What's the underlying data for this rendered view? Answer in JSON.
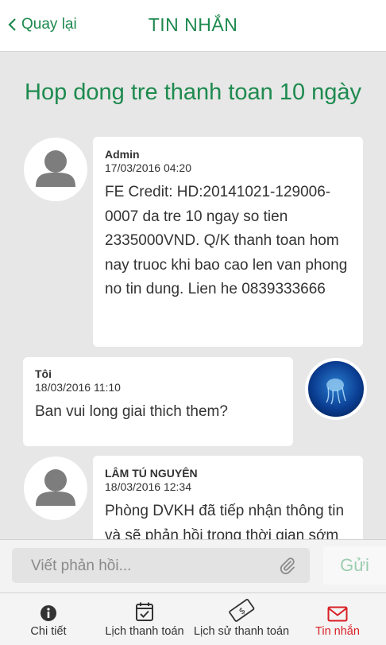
{
  "header": {
    "back_label": "Quay lại",
    "title": "TIN NHẮN"
  },
  "subject": "Hop dong tre thanh toan 10 ngày",
  "messages": [
    {
      "sender": "Admin",
      "date": "17/03/2016 04:20",
      "text": "FE Credit: HD:20141021-129006-0007 da tre 10 ngay so tien 2335000VND. Q/K thanh toan hom nay truoc khi bao cao len van phong no tin dung. Lien he 0839333666"
    },
    {
      "sender": "Tôi",
      "date": "18/03/2016 11:10",
      "text": "Ban vui long giai thich them?"
    },
    {
      "sender": "LÂM TÚ NGUYÊN",
      "date": "18/03/2016 12:34",
      "text": "Phòng DVKH đã tiếp nhận thông tin và sẽ phản hồi trong thời gian sớm nhất"
    }
  ],
  "composer": {
    "placeholder": "Viết phản hồi...",
    "send_label": "Gửi"
  },
  "tabs": [
    {
      "label": "Chi tiết",
      "icon": "info-icon"
    },
    {
      "label": "Lịch thanh toán",
      "icon": "calendar-check-icon"
    },
    {
      "label": "Lịch sử thanh toán",
      "icon": "money-bill-icon"
    },
    {
      "label": "Tin nhắn",
      "icon": "envelope-icon",
      "active": true
    }
  ],
  "colors": {
    "brand_green": "#1e8a4f",
    "active_red": "#d91f26",
    "send_disabled": "#9ccdb0"
  }
}
